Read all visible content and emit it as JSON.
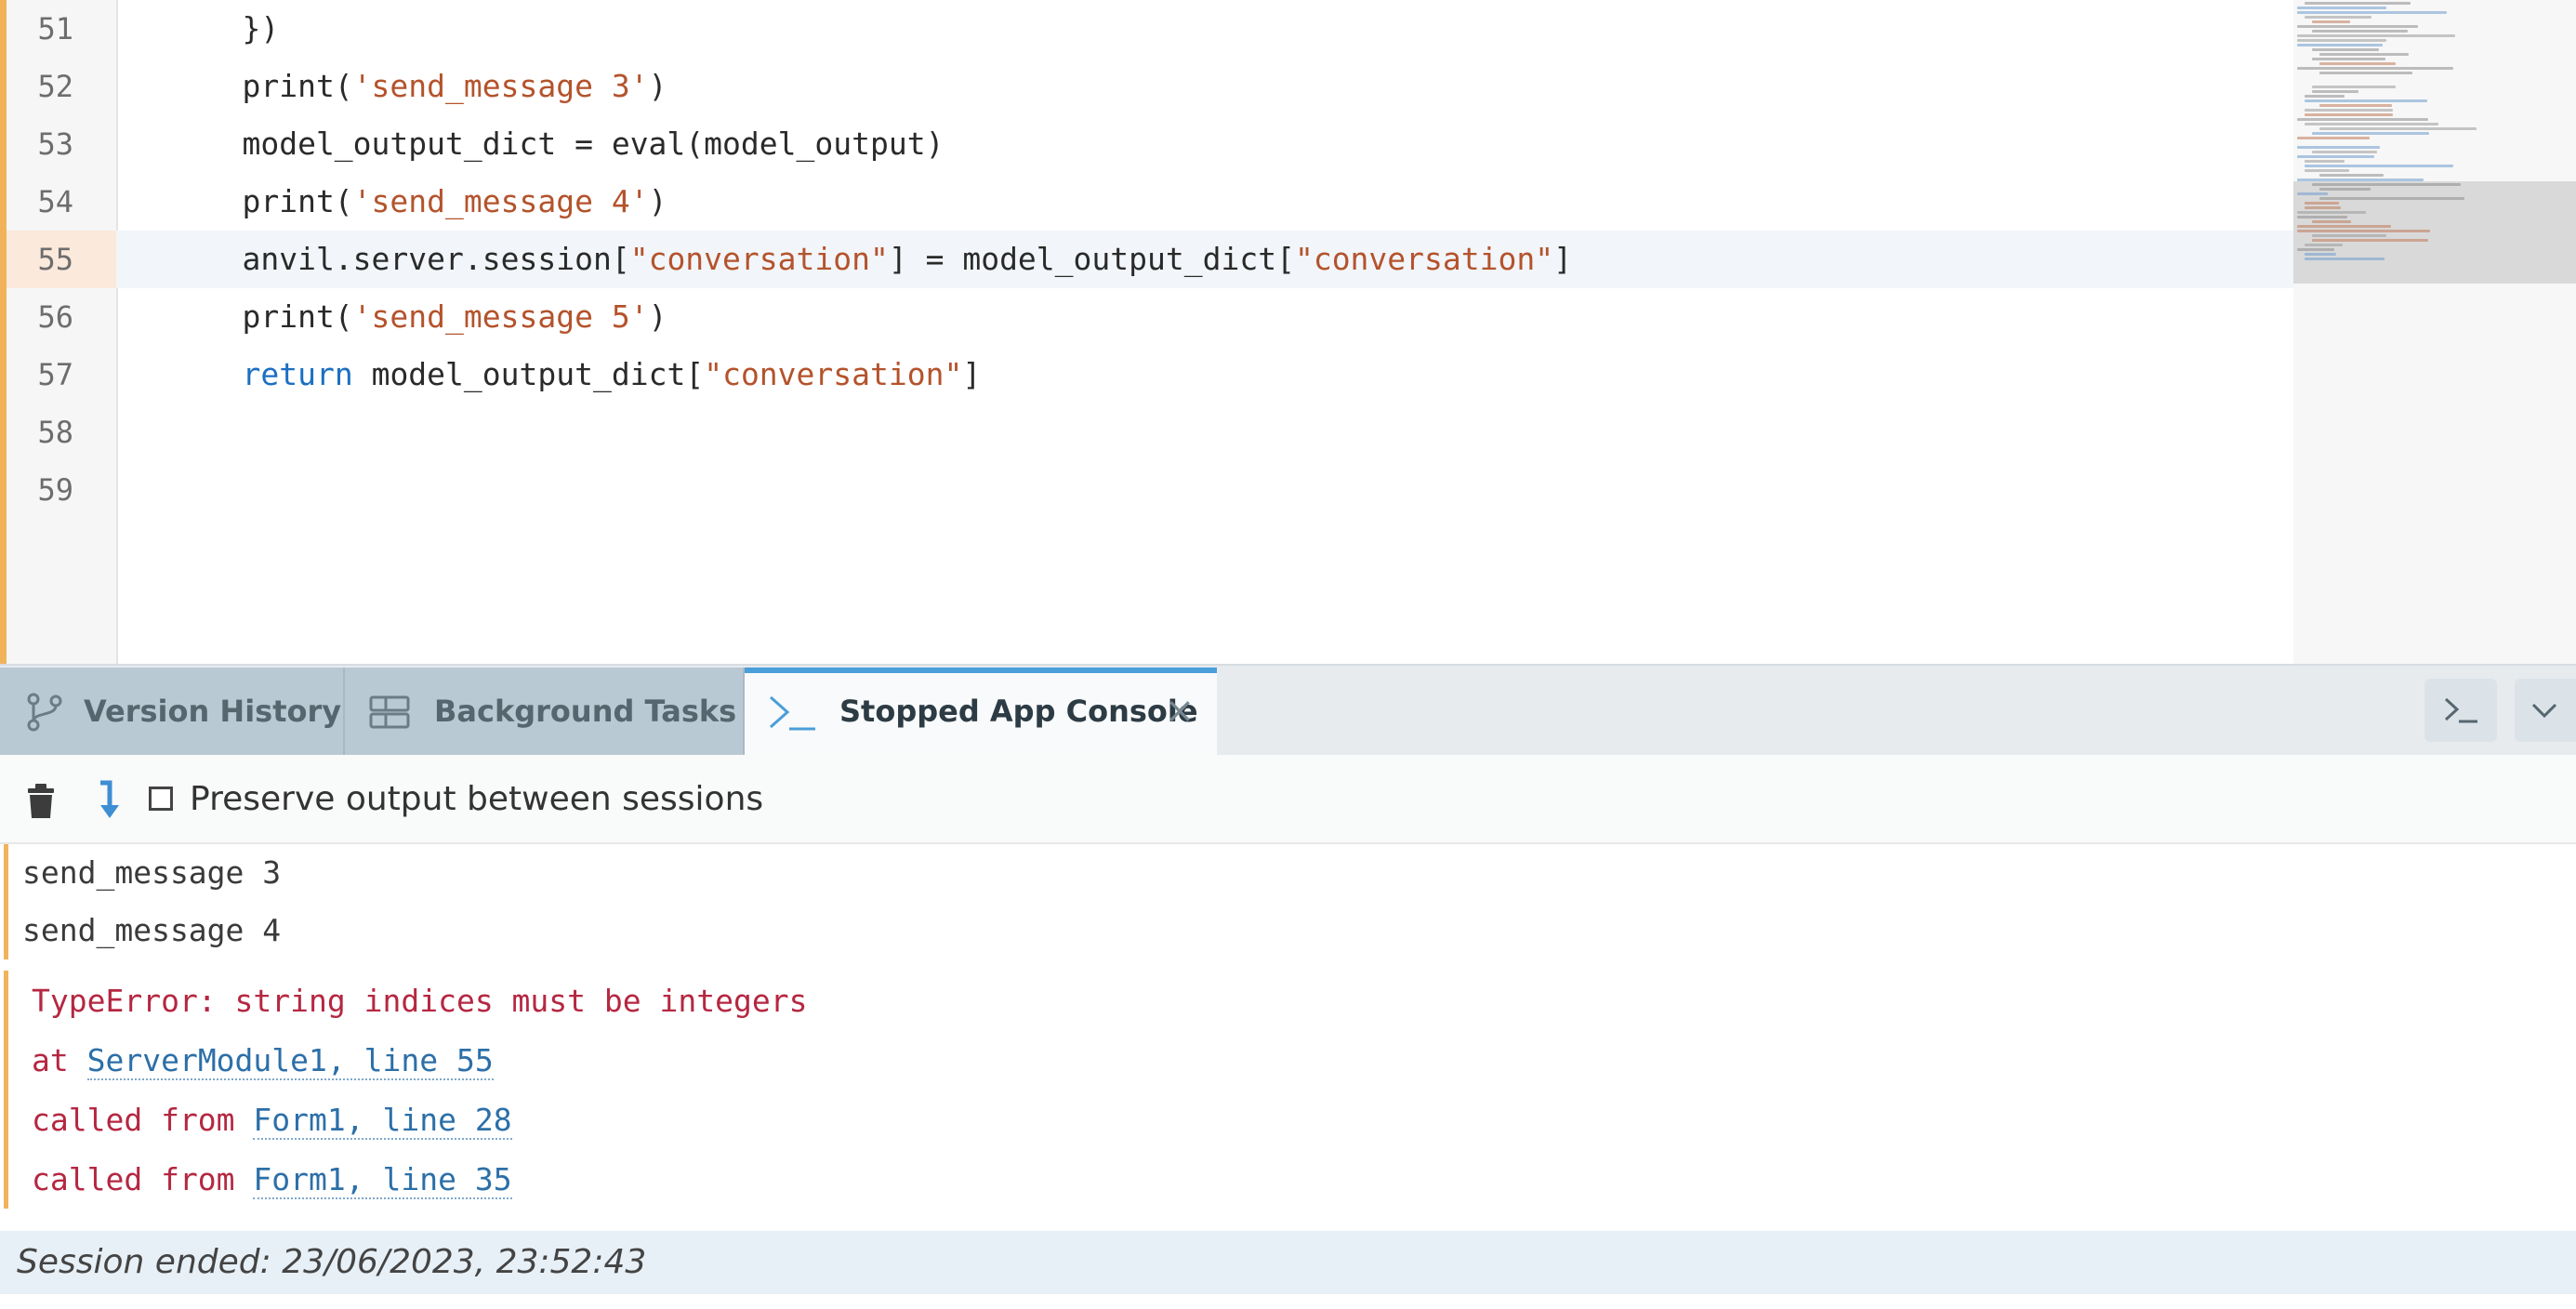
{
  "editor": {
    "lines": [
      {
        "num": "51",
        "parts": [
          {
            "t": "    })",
            "c": ""
          }
        ]
      },
      {
        "num": "52",
        "parts": [
          {
            "t": "    print(",
            "c": ""
          },
          {
            "t": "'send_message 3'",
            "c": "str"
          },
          {
            "t": ")",
            "c": ""
          }
        ]
      },
      {
        "num": "53",
        "parts": [
          {
            "t": "    model_output_dict = eval(model_output)",
            "c": ""
          }
        ]
      },
      {
        "num": "54",
        "parts": [
          {
            "t": "    print(",
            "c": ""
          },
          {
            "t": "'send_message 4'",
            "c": "str"
          },
          {
            "t": ")",
            "c": ""
          }
        ]
      },
      {
        "num": "55",
        "active": true,
        "parts": [
          {
            "t": "    anvil.server.session[",
            "c": ""
          },
          {
            "t": "\"conversation\"",
            "c": "str"
          },
          {
            "t": "] = model_output_dict[",
            "c": ""
          },
          {
            "t": "\"conversation\"",
            "c": "str"
          },
          {
            "t": "]",
            "c": ""
          }
        ]
      },
      {
        "num": "56",
        "parts": [
          {
            "t": "    print(",
            "c": ""
          },
          {
            "t": "'send_message 5'",
            "c": "str"
          },
          {
            "t": ")",
            "c": ""
          }
        ]
      },
      {
        "num": "57",
        "parts": [
          {
            "t": "    ",
            "c": ""
          },
          {
            "t": "return",
            "c": "kw"
          },
          {
            "t": " model_output_dict[",
            "c": ""
          },
          {
            "t": "\"conversation\"",
            "c": "str"
          },
          {
            "t": "]",
            "c": ""
          }
        ]
      },
      {
        "num": "58",
        "parts": []
      },
      {
        "num": "59",
        "parts": []
      }
    ]
  },
  "tabs": {
    "version_history": "Version History",
    "background_tasks": "Background Tasks",
    "stopped_app_console": "Stopped App Console",
    "close_glyph": "×"
  },
  "toolbar": {
    "preserve_label": "Preserve output between sessions",
    "preserve_checked": false
  },
  "console": {
    "output_lines": [
      "send_message 3",
      "send_message 4"
    ],
    "error": {
      "message": "TypeError: string indices must be integers",
      "trace": [
        {
          "prefix": "at ",
          "link": "ServerModule1, line 55"
        },
        {
          "prefix": "called from ",
          "link": "Form1, line 28"
        },
        {
          "prefix": "called from ",
          "link": "Form1, line 35"
        }
      ]
    },
    "session_ended": "Session ended: 23/06/2023, 23:52:43"
  },
  "colors": {
    "accent_orange": "#f0b35a",
    "active_tab_blue": "#4a9ed9",
    "error_red": "#b52741",
    "link_blue": "#2c6fa8",
    "string_brown": "#b4532c",
    "keyword_blue": "#1c6fc1"
  },
  "icons": {
    "version_history": "git-branch-icon",
    "background_tasks": "server-stack-icon",
    "console": "terminal-prompt-icon",
    "clear": "trash-icon",
    "scroll": "scroll-down-arrow-icon",
    "open_console": "terminal-icon",
    "collapse": "chevron-down-icon"
  }
}
